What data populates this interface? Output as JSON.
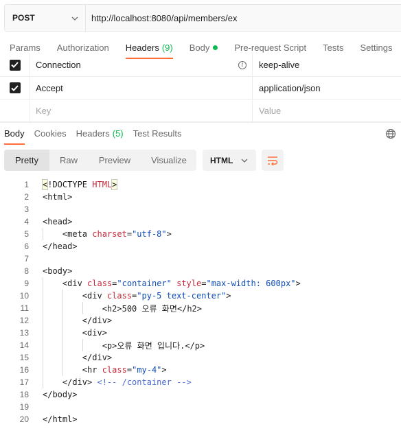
{
  "request": {
    "method": "POST",
    "url": "http://localhost:8080/api/members/ex"
  },
  "request_tabs": [
    {
      "label": "Params"
    },
    {
      "label": "Authorization"
    },
    {
      "label": "Headers",
      "count": "(9)"
    },
    {
      "label": "Body"
    },
    {
      "label": "Pre-request Script"
    },
    {
      "label": "Tests"
    },
    {
      "label": "Settings"
    }
  ],
  "headers": [
    {
      "key": "Connection",
      "value": "keep-alive",
      "checked": true
    },
    {
      "key": "Accept",
      "value": "application/json",
      "checked": true
    }
  ],
  "headers_placeholder": {
    "key": "Key",
    "value": "Value"
  },
  "response_tabs": [
    {
      "label": "Body"
    },
    {
      "label": "Cookies"
    },
    {
      "label": "Headers",
      "count": "(5)"
    },
    {
      "label": "Test Results"
    }
  ],
  "view_modes": [
    "Pretty",
    "Raw",
    "Preview",
    "Visualize"
  ],
  "format": "HTML",
  "code_lines": [
    "<!DOCTYPE HTML>",
    "<html>",
    "",
    "<head>",
    "    <meta charset=\"utf-8\">",
    "</head>",
    "",
    "<body>",
    "    <div class=\"container\" style=\"max-width: 600px\">",
    "        <div class=\"py-5 text-center\">",
    "            <h2>500 오류 화면</h2>",
    "        </div>",
    "        <div>",
    "            <p>오류 화면 입니다.</p>",
    "        </div>",
    "        <hr class=\"my-4\">",
    "    </div> <!-- /container -->",
    "</body>",
    "",
    "</html>"
  ],
  "colors": {
    "accent": "#ff6c37",
    "success": "#0cbb52"
  }
}
